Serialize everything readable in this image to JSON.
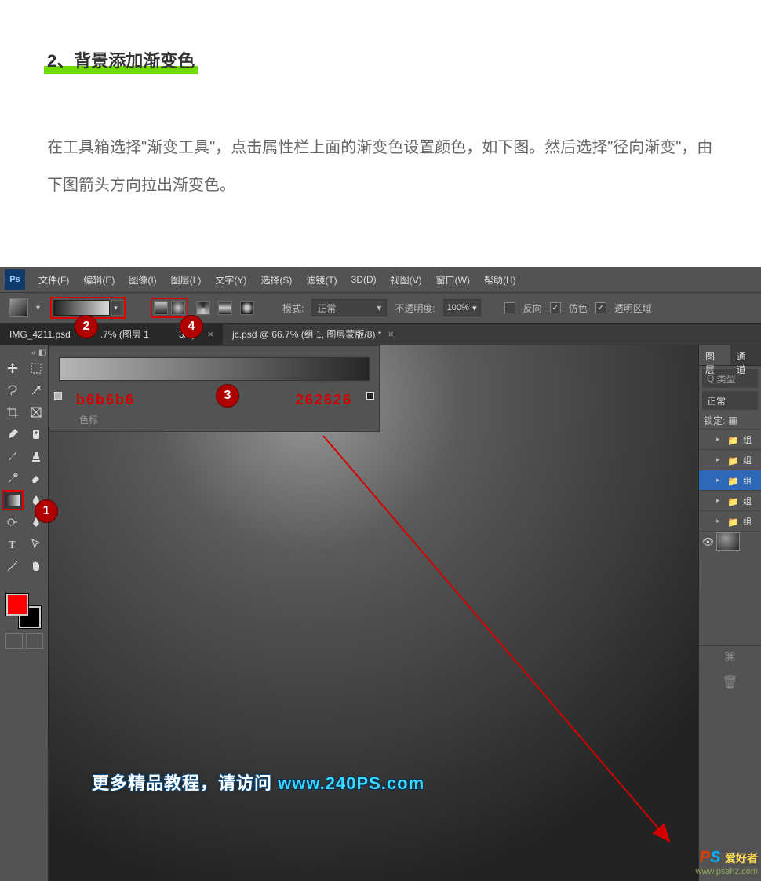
{
  "article": {
    "heading": "2、背景添加渐变色",
    "paragraph": "在工具箱选择\"渐变工具\"，点击属性栏上面的渐变色设置颜色，如下图。然后选择\"径向渐变\"，由下图箭头方向拉出渐变色。"
  },
  "menubar": {
    "logo": "Ps",
    "items": [
      "文件(F)",
      "编辑(E)",
      "图像(I)",
      "图层(L)",
      "文字(Y)",
      "选择(S)",
      "滤镜(T)",
      "3D(D)",
      "视图(V)",
      "窗口(W)",
      "帮助(H)"
    ]
  },
  "optionsbar": {
    "mode_label": "模式:",
    "mode_value": "正常",
    "opacity_label": "不透明度:",
    "opacity_value": "100%",
    "reverse": "反向",
    "dither": "仿色",
    "transparency": "透明区域"
  },
  "tabs": [
    {
      "label": "IMG_4211.psd",
      "suffix": ".7% (图层 1",
      "suffix2": "3/8) *"
    },
    {
      "label": "jc.psd @ 66.7% (组 1, 图层蒙版/8) *"
    }
  ],
  "gradient_editor": {
    "left_color": "b6b6b6",
    "right_color": "262626",
    "stops_label": "色标"
  },
  "markers": {
    "m1": "1",
    "m2": "2",
    "m3": "3",
    "m4": "4"
  },
  "layers_panel": {
    "tab1": "图层",
    "tab2": "通道",
    "search_label": "类型",
    "blend_mode": "正常",
    "lock_label": "锁定:",
    "layers": [
      "组",
      "组",
      "组",
      "组",
      "组"
    ]
  },
  "watermark": {
    "text_cn": "更多精品教程，请访问 ",
    "text_en": "www.240PS.com",
    "corner_ps": "PS",
    "corner_zh": "爱好者",
    "corner_url": "www.psahz.com"
  }
}
